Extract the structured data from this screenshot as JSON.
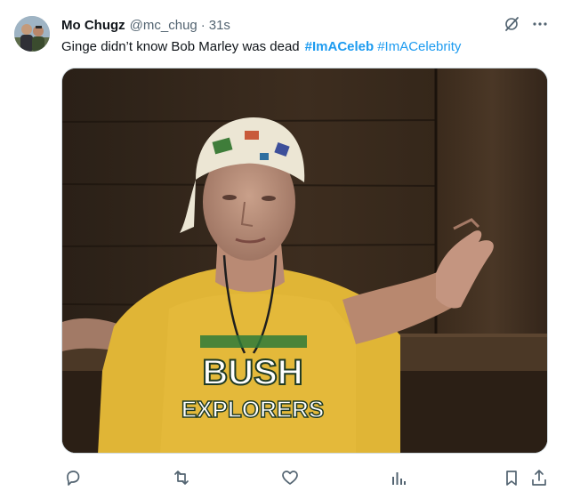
{
  "tweet": {
    "author_name": "Mo Chugz",
    "author_handle": "@mc_chug",
    "separator": "·",
    "time": "31s",
    "text": "Ginge didn’t know Bob Marley was dead",
    "hashtags": [
      "#ImACeleb",
      "#ImACelebrity"
    ]
  },
  "media": {
    "shirt_line1": "BUSH",
    "shirt_line2": "EXPLORERS"
  },
  "icons": {
    "top": [
      "grok-icon",
      "more-icon"
    ],
    "actions": [
      "reply-icon",
      "retweet-icon",
      "like-icon",
      "views-icon",
      "bookmark-icon",
      "share-icon"
    ]
  },
  "colors": {
    "accent": "#1d9bf0",
    "text": "#0f1419",
    "muted": "#536471"
  }
}
